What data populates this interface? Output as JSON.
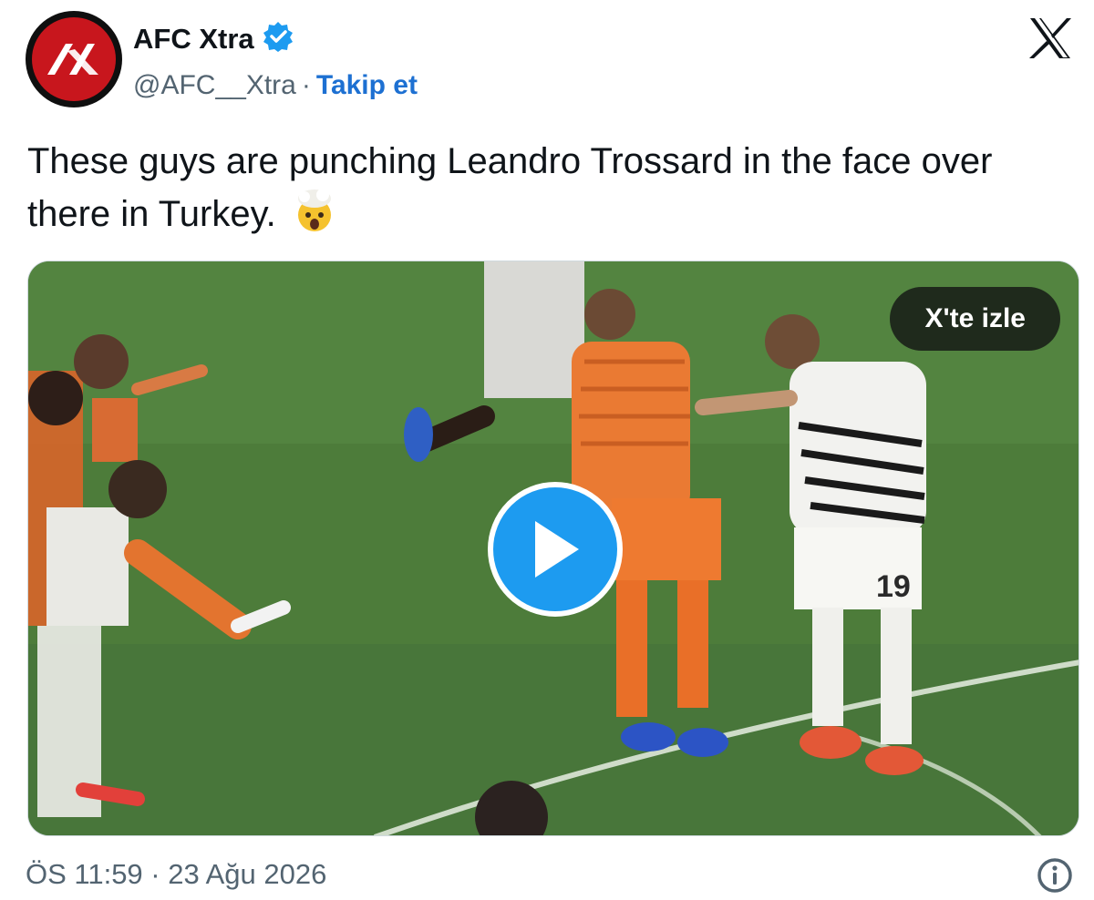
{
  "author": {
    "display_name": "AFC Xtra",
    "handle": "@AFC__Xtra",
    "separator": "·",
    "follow_label": "Takip et"
  },
  "tweet": {
    "text": "These guys are punching Leandro Trossard in the face over there in Turkey.",
    "emoji": "exploding-head-emoji"
  },
  "media": {
    "watch_label": "X'te izle",
    "jersey_number": "19"
  },
  "footer": {
    "timestamp": "ÖS 11:59 · 23 Ağu 2026"
  },
  "colors": {
    "link": "#1d70d2",
    "verified": "#1d9bf0",
    "pitch": "#4f7f3b"
  }
}
